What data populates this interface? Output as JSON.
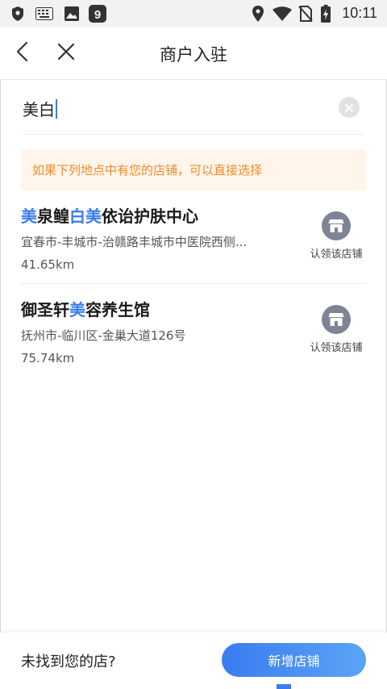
{
  "status_bar": {
    "time": "10:11",
    "icons": [
      "shield-icon",
      "keyboard-icon",
      "image-icon",
      "app-badge-icon",
      "location-icon",
      "wifi-icon",
      "no-sim-icon",
      "battery-charging-icon"
    ]
  },
  "header": {
    "title": "商户入驻"
  },
  "search": {
    "value": "美白"
  },
  "notice": "如果下列地点中有您的店铺，可以直接选择",
  "stores": [
    {
      "name_parts": [
        {
          "text": "美",
          "highlight": true
        },
        {
          "text": "泉鳇",
          "highlight": false
        },
        {
          "text": "白美",
          "highlight": true
        },
        {
          "text": "依诒护肤中心",
          "highlight": false
        }
      ],
      "address": "宜春市-丰城市-治赣路丰城市中医院西侧...",
      "distance": "41.65km",
      "claim_label": "认领该店铺"
    },
    {
      "name_parts": [
        {
          "text": "御圣轩",
          "highlight": false
        },
        {
          "text": "美",
          "highlight": true
        },
        {
          "text": "容养生馆",
          "highlight": false
        }
      ],
      "address": "抚州市-临川区-金巢大道126号",
      "distance": "75.74km",
      "claim_label": "认领该店铺"
    }
  ],
  "bottom": {
    "prompt": "未找到您的店?",
    "add_button": "新增店铺"
  },
  "colors": {
    "accent": "#3a7cf0",
    "notice_text": "#f08c2a",
    "notice_bg": "#fff5ea"
  }
}
